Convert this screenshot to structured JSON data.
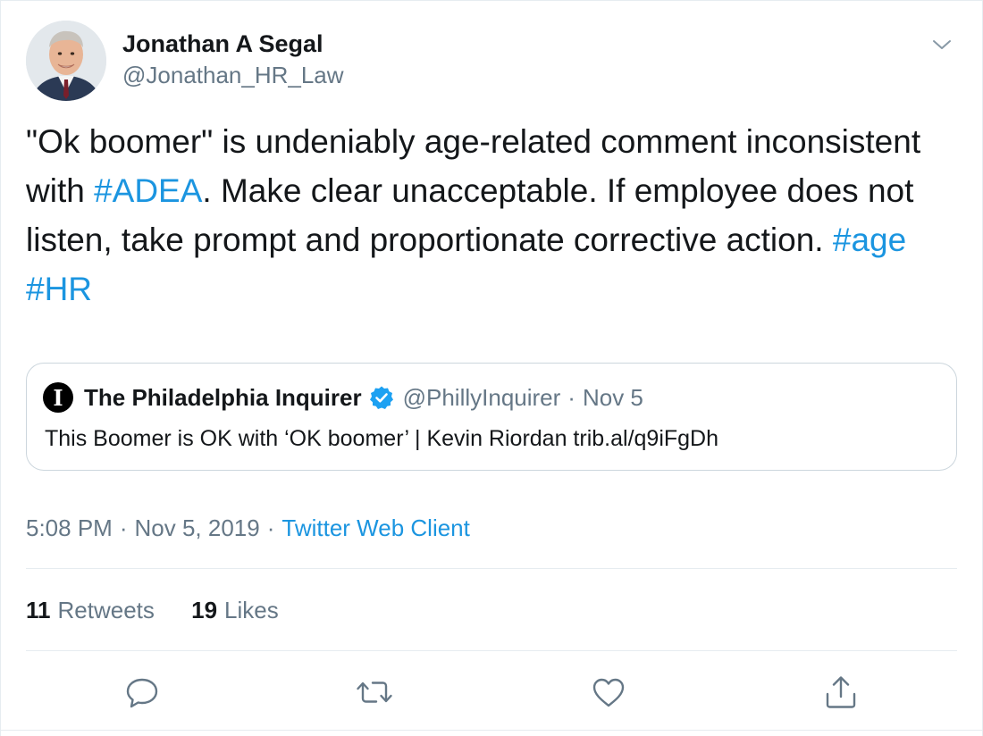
{
  "author": {
    "display_name": "Jonathan A Segal",
    "handle": "@Jonathan_HR_Law"
  },
  "tweet": {
    "segments": [
      {
        "text": "\"Ok boomer\" is undeniably age-related comment inconsistent with ",
        "type": "text"
      },
      {
        "text": "#ADEA",
        "type": "hashtag"
      },
      {
        "text": ".  Make clear unacceptable.  If employee does not listen, take prompt and proportionate corrective action.  ",
        "type": "text"
      },
      {
        "text": "#age",
        "type": "hashtag"
      },
      {
        "text": " ",
        "type": "text"
      },
      {
        "text": "#HR",
        "type": "hashtag"
      }
    ]
  },
  "quoted_tweet": {
    "logo_letter": "I",
    "name": "The Philadelphia Inquirer",
    "handle": "@PhillyInquirer",
    "separator": "·",
    "date": "Nov 5",
    "text": "This Boomer is OK with ‘OK boomer’ | Kevin Riordan trib.al/q9iFgDh"
  },
  "meta": {
    "time": "5:08 PM",
    "separator": "·",
    "date": "Nov 5, 2019",
    "client": "Twitter Web Client"
  },
  "stats": {
    "retweets_count": "11",
    "retweets_label": "Retweets",
    "likes_count": "19",
    "likes_label": "Likes"
  },
  "icons": {
    "menu": "chevron-down-icon",
    "reply": "reply-icon",
    "retweet": "retweet-icon",
    "like": "like-icon",
    "share": "share-icon",
    "verified": "verified-badge-icon"
  },
  "colors": {
    "link": "#1b95e0",
    "secondary_text": "#657786",
    "primary_text": "#14171a",
    "border": "#ccd6dd",
    "verified": "#1da1f2"
  }
}
